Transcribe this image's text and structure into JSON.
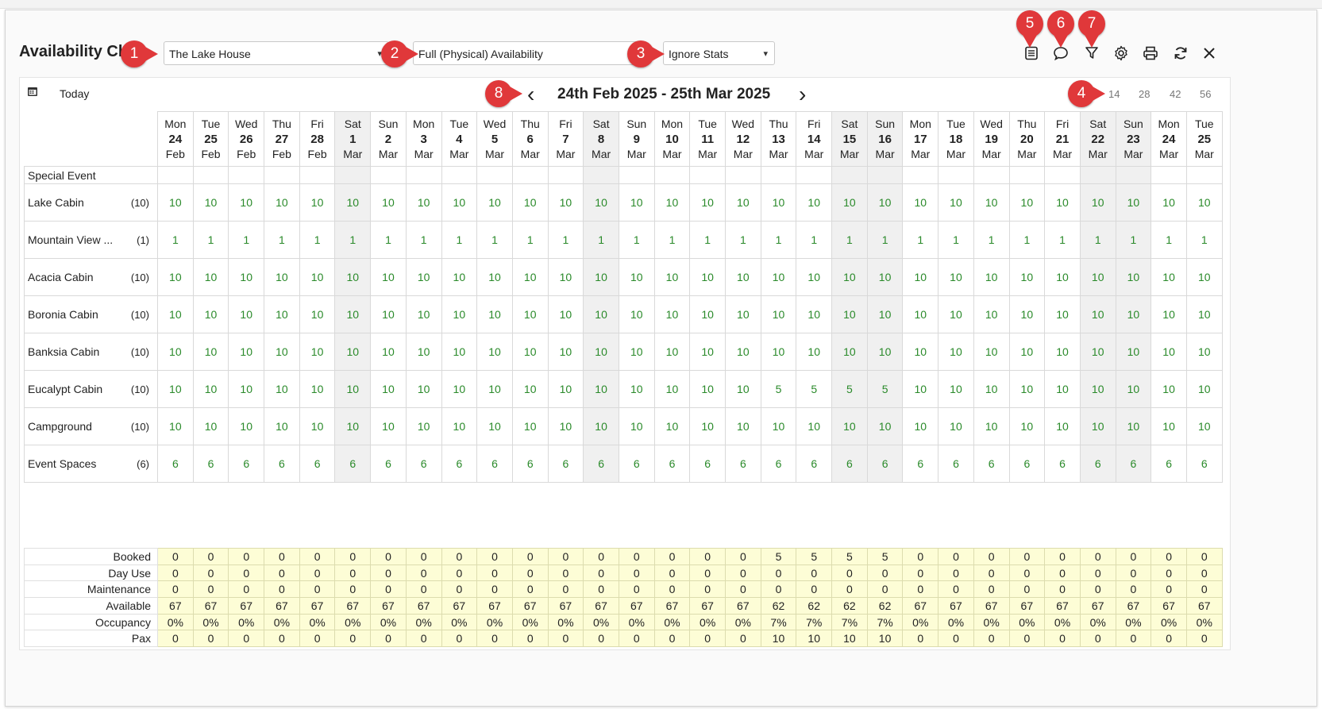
{
  "title": "Availability Ch",
  "property_select": "The Lake House",
  "availability_select": "Full (Physical) Availability",
  "stats_select": "Ignore Stats",
  "badges": [
    "1",
    "2",
    "3",
    "4",
    "5",
    "6",
    "7",
    "8"
  ],
  "nav": {
    "today": "Today",
    "range": "24th Feb 2025 - 25th Mar 2025",
    "prev": "‹",
    "next": "›"
  },
  "range_options": [
    "14",
    "28",
    "42",
    "56"
  ],
  "days": [
    {
      "dow": "Mon",
      "d": "24",
      "m": "Feb",
      "we": false
    },
    {
      "dow": "Tue",
      "d": "25",
      "m": "Feb",
      "we": false
    },
    {
      "dow": "Wed",
      "d": "26",
      "m": "Feb",
      "we": false
    },
    {
      "dow": "Thu",
      "d": "27",
      "m": "Feb",
      "we": false
    },
    {
      "dow": "Fri",
      "d": "28",
      "m": "Feb",
      "we": false
    },
    {
      "dow": "Sat",
      "d": "1",
      "m": "Mar",
      "we": true
    },
    {
      "dow": "Sun",
      "d": "2",
      "m": "Mar",
      "we": false
    },
    {
      "dow": "Mon",
      "d": "3",
      "m": "Mar",
      "we": false
    },
    {
      "dow": "Tue",
      "d": "4",
      "m": "Mar",
      "we": false
    },
    {
      "dow": "Wed",
      "d": "5",
      "m": "Mar",
      "we": false
    },
    {
      "dow": "Thu",
      "d": "6",
      "m": "Mar",
      "we": false
    },
    {
      "dow": "Fri",
      "d": "7",
      "m": "Mar",
      "we": false
    },
    {
      "dow": "Sat",
      "d": "8",
      "m": "Mar",
      "we": true
    },
    {
      "dow": "Sun",
      "d": "9",
      "m": "Mar",
      "we": false
    },
    {
      "dow": "Mon",
      "d": "10",
      "m": "Mar",
      "we": false
    },
    {
      "dow": "Tue",
      "d": "11",
      "m": "Mar",
      "we": false
    },
    {
      "dow": "Wed",
      "d": "12",
      "m": "Mar",
      "we": false
    },
    {
      "dow": "Thu",
      "d": "13",
      "m": "Mar",
      "we": false
    },
    {
      "dow": "Fri",
      "d": "14",
      "m": "Mar",
      "we": false
    },
    {
      "dow": "Sat",
      "d": "15",
      "m": "Mar",
      "we": true
    },
    {
      "dow": "Sun",
      "d": "16",
      "m": "Mar",
      "we": true
    },
    {
      "dow": "Mon",
      "d": "17",
      "m": "Mar",
      "we": false
    },
    {
      "dow": "Tue",
      "d": "18",
      "m": "Mar",
      "we": false
    },
    {
      "dow": "Wed",
      "d": "19",
      "m": "Mar",
      "we": false
    },
    {
      "dow": "Thu",
      "d": "20",
      "m": "Mar",
      "we": false
    },
    {
      "dow": "Fri",
      "d": "21",
      "m": "Mar",
      "we": false
    },
    {
      "dow": "Sat",
      "d": "22",
      "m": "Mar",
      "we": true
    },
    {
      "dow": "Sun",
      "d": "23",
      "m": "Mar",
      "we": true
    },
    {
      "dow": "Mon",
      "d": "24",
      "m": "Mar",
      "we": false
    },
    {
      "dow": "Tue",
      "d": "25",
      "m": "Mar",
      "we": false
    }
  ],
  "special_event_label": "Special Event",
  "rooms": [
    {
      "name": "Lake Cabin",
      "count": "(10)",
      "values": [
        "10",
        "10",
        "10",
        "10",
        "10",
        "10",
        "10",
        "10",
        "10",
        "10",
        "10",
        "10",
        "10",
        "10",
        "10",
        "10",
        "10",
        "10",
        "10",
        "10",
        "10",
        "10",
        "10",
        "10",
        "10",
        "10",
        "10",
        "10",
        "10",
        "10"
      ]
    },
    {
      "name": "Mountain View ...",
      "count": "(1)",
      "values": [
        "1",
        "1",
        "1",
        "1",
        "1",
        "1",
        "1",
        "1",
        "1",
        "1",
        "1",
        "1",
        "1",
        "1",
        "1",
        "1",
        "1",
        "1",
        "1",
        "1",
        "1",
        "1",
        "1",
        "1",
        "1",
        "1",
        "1",
        "1",
        "1",
        "1"
      ]
    },
    {
      "name": "Acacia Cabin",
      "count": "(10)",
      "values": [
        "10",
        "10",
        "10",
        "10",
        "10",
        "10",
        "10",
        "10",
        "10",
        "10",
        "10",
        "10",
        "10",
        "10",
        "10",
        "10",
        "10",
        "10",
        "10",
        "10",
        "10",
        "10",
        "10",
        "10",
        "10",
        "10",
        "10",
        "10",
        "10",
        "10"
      ]
    },
    {
      "name": "Boronia Cabin",
      "count": "(10)",
      "values": [
        "10",
        "10",
        "10",
        "10",
        "10",
        "10",
        "10",
        "10",
        "10",
        "10",
        "10",
        "10",
        "10",
        "10",
        "10",
        "10",
        "10",
        "10",
        "10",
        "10",
        "10",
        "10",
        "10",
        "10",
        "10",
        "10",
        "10",
        "10",
        "10",
        "10"
      ]
    },
    {
      "name": "Banksia Cabin",
      "count": "(10)",
      "values": [
        "10",
        "10",
        "10",
        "10",
        "10",
        "10",
        "10",
        "10",
        "10",
        "10",
        "10",
        "10",
        "10",
        "10",
        "10",
        "10",
        "10",
        "10",
        "10",
        "10",
        "10",
        "10",
        "10",
        "10",
        "10",
        "10",
        "10",
        "10",
        "10",
        "10"
      ]
    },
    {
      "name": "Eucalypt Cabin",
      "count": "(10)",
      "values": [
        "10",
        "10",
        "10",
        "10",
        "10",
        "10",
        "10",
        "10",
        "10",
        "10",
        "10",
        "10",
        "10",
        "10",
        "10",
        "10",
        "10",
        "5",
        "5",
        "5",
        "5",
        "10",
        "10",
        "10",
        "10",
        "10",
        "10",
        "10",
        "10",
        "10"
      ]
    },
    {
      "name": "Campground",
      "count": "(10)",
      "values": [
        "10",
        "10",
        "10",
        "10",
        "10",
        "10",
        "10",
        "10",
        "10",
        "10",
        "10",
        "10",
        "10",
        "10",
        "10",
        "10",
        "10",
        "10",
        "10",
        "10",
        "10",
        "10",
        "10",
        "10",
        "10",
        "10",
        "10",
        "10",
        "10",
        "10"
      ]
    },
    {
      "name": "Event Spaces",
      "count": "(6)",
      "values": [
        "6",
        "6",
        "6",
        "6",
        "6",
        "6",
        "6",
        "6",
        "6",
        "6",
        "6",
        "6",
        "6",
        "6",
        "6",
        "6",
        "6",
        "6",
        "6",
        "6",
        "6",
        "6",
        "6",
        "6",
        "6",
        "6",
        "6",
        "6",
        "6",
        "6"
      ]
    }
  ],
  "stats": [
    {
      "label": "Booked",
      "values": [
        "0",
        "0",
        "0",
        "0",
        "0",
        "0",
        "0",
        "0",
        "0",
        "0",
        "0",
        "0",
        "0",
        "0",
        "0",
        "0",
        "0",
        "5",
        "5",
        "5",
        "5",
        "0",
        "0",
        "0",
        "0",
        "0",
        "0",
        "0",
        "0",
        "0"
      ]
    },
    {
      "label": "Day Use",
      "values": [
        "0",
        "0",
        "0",
        "0",
        "0",
        "0",
        "0",
        "0",
        "0",
        "0",
        "0",
        "0",
        "0",
        "0",
        "0",
        "0",
        "0",
        "0",
        "0",
        "0",
        "0",
        "0",
        "0",
        "0",
        "0",
        "0",
        "0",
        "0",
        "0",
        "0"
      ]
    },
    {
      "label": "Maintenance",
      "values": [
        "0",
        "0",
        "0",
        "0",
        "0",
        "0",
        "0",
        "0",
        "0",
        "0",
        "0",
        "0",
        "0",
        "0",
        "0",
        "0",
        "0",
        "0",
        "0",
        "0",
        "0",
        "0",
        "0",
        "0",
        "0",
        "0",
        "0",
        "0",
        "0",
        "0"
      ]
    },
    {
      "label": "Available",
      "values": [
        "67",
        "67",
        "67",
        "67",
        "67",
        "67",
        "67",
        "67",
        "67",
        "67",
        "67",
        "67",
        "67",
        "67",
        "67",
        "67",
        "67",
        "62",
        "62",
        "62",
        "62",
        "67",
        "67",
        "67",
        "67",
        "67",
        "67",
        "67",
        "67",
        "67"
      ]
    },
    {
      "label": "Occupancy",
      "values": [
        "0%",
        "0%",
        "0%",
        "0%",
        "0%",
        "0%",
        "0%",
        "0%",
        "0%",
        "0%",
        "0%",
        "0%",
        "0%",
        "0%",
        "0%",
        "0%",
        "0%",
        "7%",
        "7%",
        "7%",
        "7%",
        "0%",
        "0%",
        "0%",
        "0%",
        "0%",
        "0%",
        "0%",
        "0%",
        "0%"
      ]
    },
    {
      "label": "Pax",
      "values": [
        "0",
        "0",
        "0",
        "0",
        "0",
        "0",
        "0",
        "0",
        "0",
        "0",
        "0",
        "0",
        "0",
        "0",
        "0",
        "0",
        "0",
        "10",
        "10",
        "10",
        "10",
        "0",
        "0",
        "0",
        "0",
        "0",
        "0",
        "0",
        "0",
        "0"
      ]
    }
  ],
  "colors": {
    "available_text": "#2a8a2a",
    "weekend_bg": "#f0f0f0",
    "stats_bg": "#fdfdd6",
    "badge": "#e0383a"
  },
  "toolbar_icons": [
    "list-icon",
    "comment-icon",
    "filter-icon",
    "gear-icon",
    "print-icon",
    "refresh-icon",
    "close-icon"
  ]
}
